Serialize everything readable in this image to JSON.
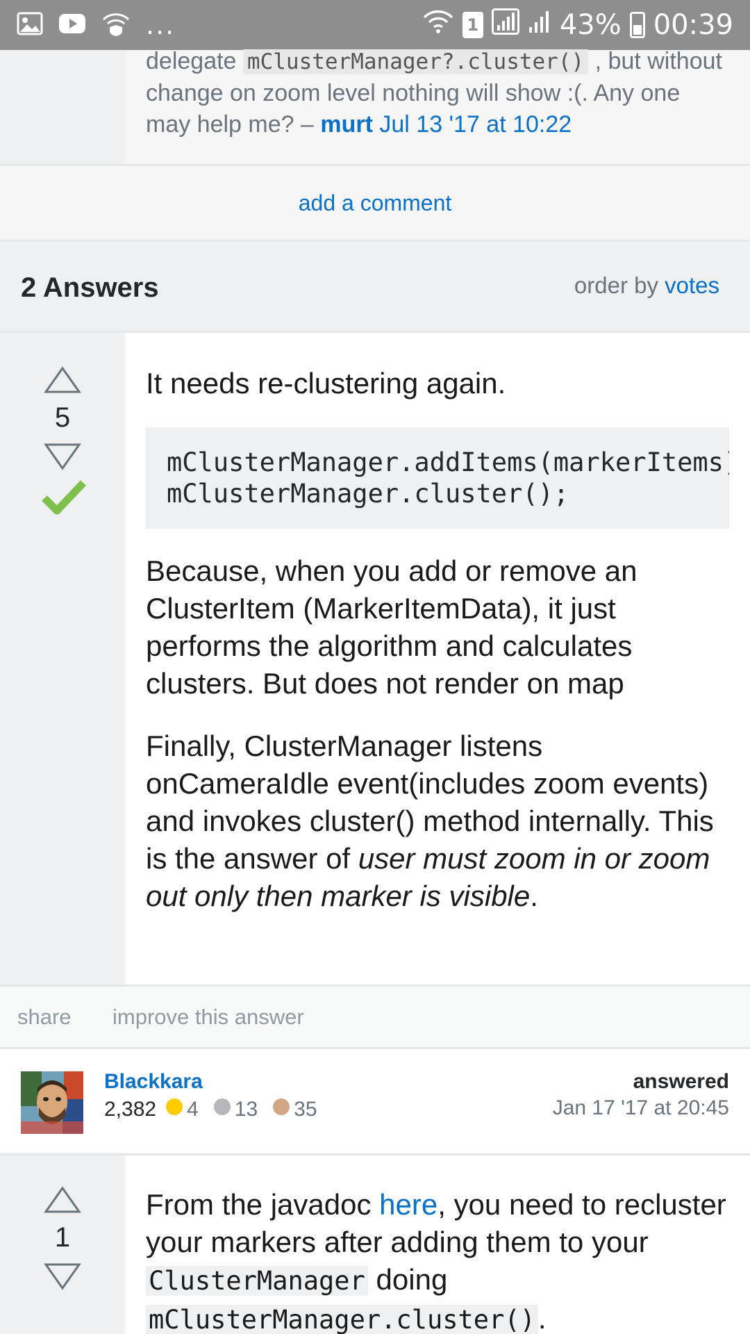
{
  "status_bar": {
    "left_icons": [
      "image-icon",
      "youtube-icon",
      "wifi-shield-icon"
    ],
    "overflow": "...",
    "sim_slot": "1",
    "battery": "43%",
    "time": "00:39"
  },
  "question_comment": {
    "code": "mClusterManager?.cluster()",
    "prefix": "delegate",
    "after_code": ", but without change on zoom level nothing will show :(. Any one may help me? –",
    "user": "murt",
    "date": "Jul 13 '17 at 10:22"
  },
  "add_comment_label": "add a comment",
  "answers_header": {
    "title": "2 Answers",
    "order_by_label": "order by",
    "order_by_value": "votes"
  },
  "answers": [
    {
      "votes": "5",
      "accepted": true,
      "lead": "It needs re-clustering again.",
      "code_lines": [
        "mClusterManager.addItems(markerItems);",
        "mClusterManager.cluster();"
      ],
      "para1": "Because, when you add or remove an ClusterItem (MarkerItemData), it just performs the algorithm and calculates clusters. But does not render on map",
      "para2_plain": "Finally, ClusterManager listens onCameraIdle event(includes zoom events) and invokes cluster() method internally. This is the answer of ",
      "para2_em": "user must zoom in or zoom out only then marker is visible",
      "para2_end": ".",
      "actions": {
        "share": "share",
        "improve": "improve this answer"
      },
      "author": {
        "name": "Blackkara",
        "reputation": "2,382",
        "gold": "4",
        "silver": "13",
        "bronze": "35",
        "answered_label": "answered",
        "answered_date": "Jan 17 '17 at 20:45"
      }
    },
    {
      "votes": "1",
      "text_a": "From the javadoc ",
      "link": "here",
      "text_b": ", you need to recluster your markers after adding them to your ",
      "code_a": "ClusterManager",
      "text_c": " doing ",
      "code_b": "mClusterManager.cluster()",
      "text_d": "."
    }
  ],
  "colors": {
    "link": "#0a70c8",
    "accepted": "#7fbf4d",
    "gold_badge": "#ffcc01",
    "silver_badge": "#b4b8bc",
    "bronze_badge": "#d1a684"
  }
}
